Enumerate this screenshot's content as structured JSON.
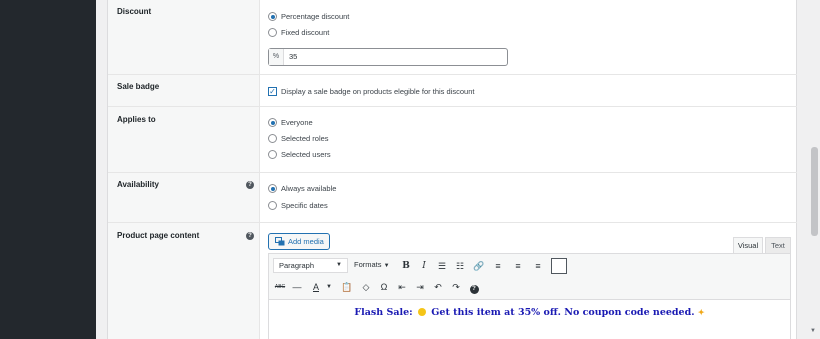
{
  "sections": {
    "discount": {
      "label": "Discount",
      "options": [
        "Percentage discount",
        "Fixed discount"
      ],
      "selected": 0,
      "input_prefix": "%",
      "input_value": "35"
    },
    "sale_badge": {
      "label": "Sale badge",
      "checkbox_label": "Display a sale badge on products elegible for this discount",
      "checked": true
    },
    "applies_to": {
      "label": "Applies to",
      "options": [
        "Everyone",
        "Selected roles",
        "Selected users"
      ],
      "selected": 0
    },
    "availability": {
      "label": "Availability",
      "options": [
        "Always available",
        "Specific dates"
      ],
      "selected": 0
    },
    "product_page_content": {
      "label": "Product page content"
    }
  },
  "editor": {
    "add_media_label": "Add media",
    "tabs": [
      "Visual",
      "Text"
    ],
    "active_tab": "Visual",
    "paragraph_select": "Paragraph",
    "formats_label": "Formats",
    "content_text_before": "Flash Sale: ",
    "content_text_after": " Get this item at 35% off. No coupon code needed.",
    "text_color": "#1a1ab3"
  },
  "toolbar": {
    "row1": [
      "bold-icon",
      "italic-icon",
      "bullet-list-icon",
      "numbered-list-icon",
      "link-icon",
      "align-left-icon",
      "align-center-icon",
      "align-right-icon",
      "toolbar-toggle-icon"
    ],
    "row2": [
      "strikethrough-icon",
      "horizontal-line-icon",
      "text-color-icon",
      "paste-text-icon",
      "clear-formatting-icon",
      "special-character-icon",
      "outdent-icon",
      "indent-icon",
      "undo-icon",
      "redo-icon",
      "help-icon"
    ]
  },
  "colors": {
    "accent": "#2271b1",
    "admin_bar": "#23282d"
  }
}
